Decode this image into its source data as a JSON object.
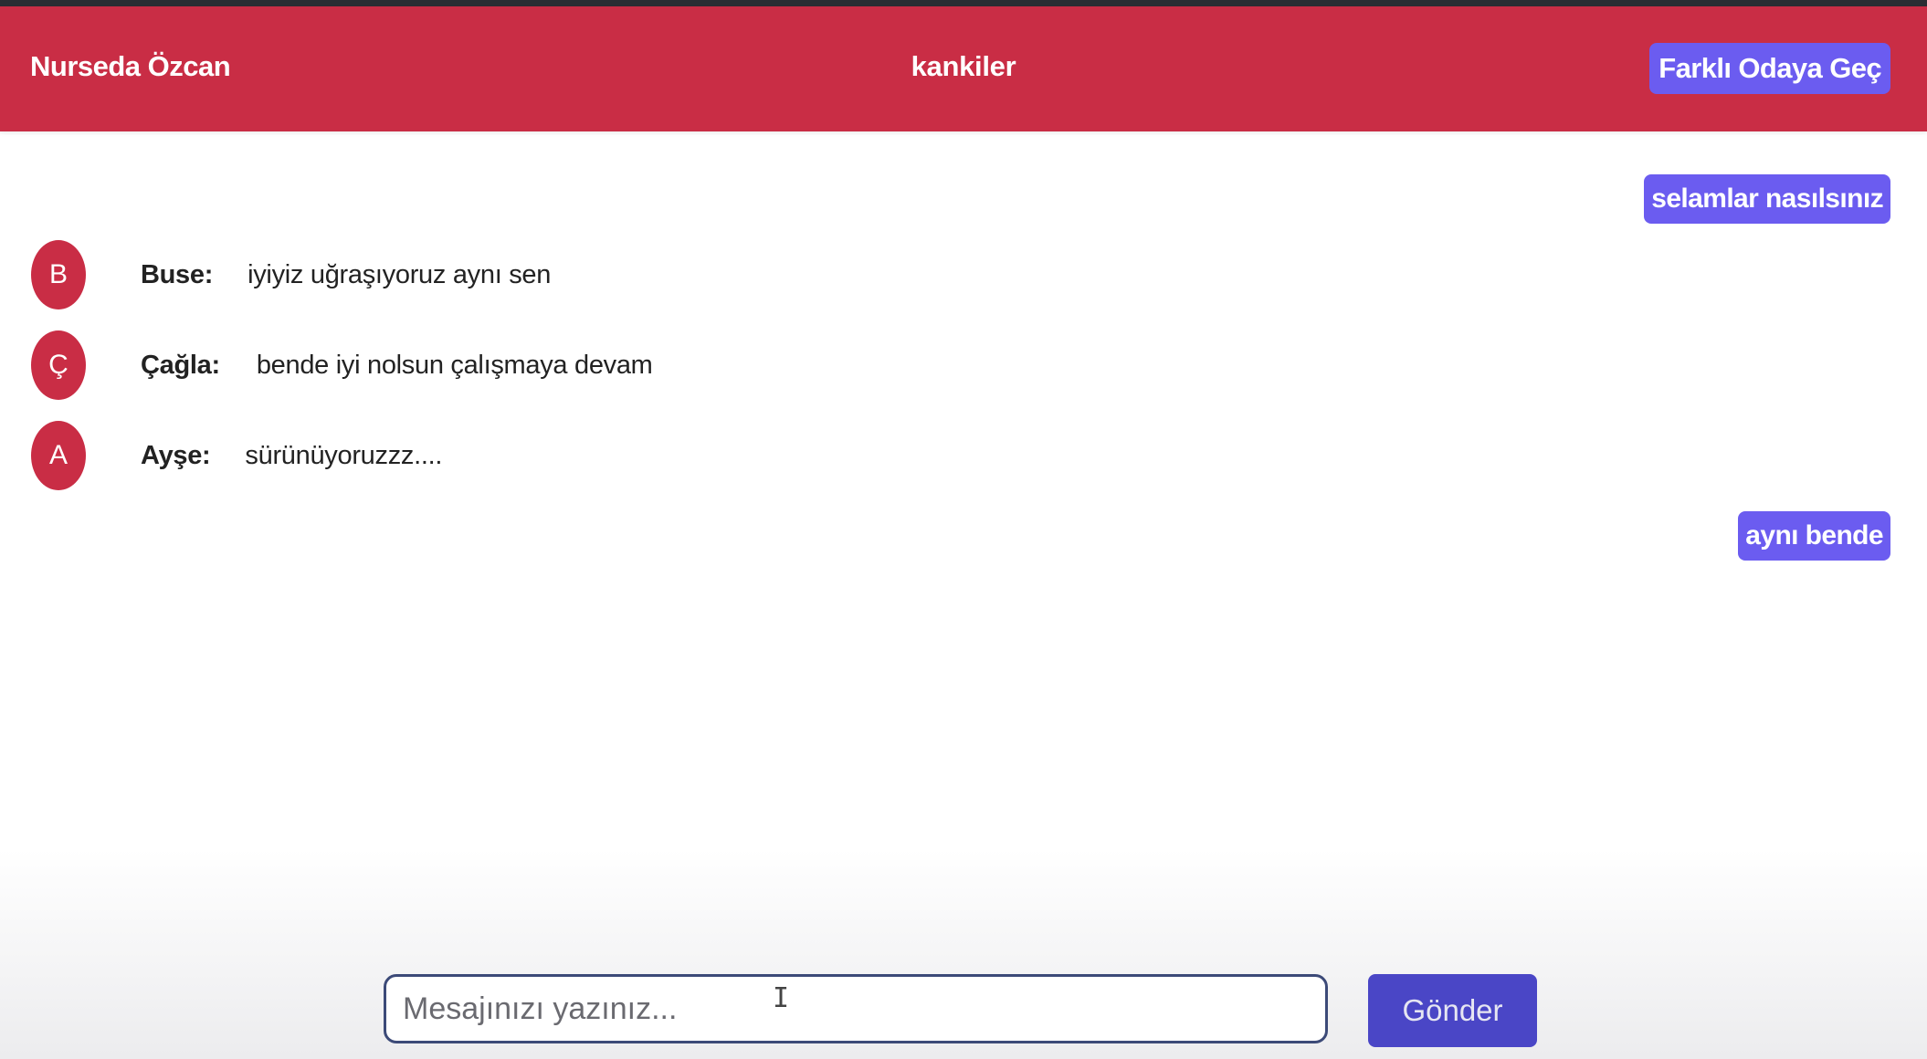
{
  "header": {
    "username": "Nurseda Özcan",
    "room_name": "kankiler",
    "switch_room_label": "Farklı Odaya Geç"
  },
  "messages": [
    {
      "type": "own",
      "text": "selamlar nasılsınız"
    },
    {
      "type": "other",
      "avatar_letter": "B",
      "sender": "Buse:",
      "text": "iyiyiz uğraşıyoruz aynı sen"
    },
    {
      "type": "other",
      "avatar_letter": "Ç",
      "sender": "Çağla:",
      "text": "bende iyi nolsun çalışmaya devam"
    },
    {
      "type": "other",
      "avatar_letter": "A",
      "sender": "Ayşe:",
      "text": "sürünüyoruzzz...."
    },
    {
      "type": "own",
      "text": "aynı bende"
    }
  ],
  "composer": {
    "placeholder": "Mesajınızı yazınız...",
    "value": "",
    "send_label": "Gönder"
  },
  "colors": {
    "header_bg": "#c92d45",
    "accent": "#6b5cf0",
    "send_button": "#4a46c6"
  }
}
